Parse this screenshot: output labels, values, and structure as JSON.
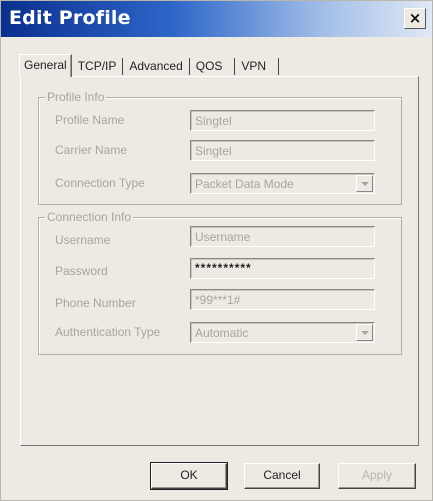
{
  "dialog": {
    "title": "Edit Profile",
    "close_label": "×"
  },
  "tabs": [
    {
      "label": "General",
      "active": true
    },
    {
      "label": "TCP/IP"
    },
    {
      "label": "Advanced"
    },
    {
      "label": "QOS"
    },
    {
      "label": "VPN"
    }
  ],
  "profile_info": {
    "legend": "Profile Info",
    "profile_name_label": "Profile Name",
    "profile_name_value": "Singtel",
    "carrier_name_label": "Carrier Name",
    "carrier_name_value": "Singtel",
    "connection_type_label": "Connection Type",
    "connection_type_value": "Packet Data Mode"
  },
  "connection_info": {
    "legend": "Connection Info",
    "username_label": "Username",
    "username_value": "Username",
    "password_label": "Password",
    "password_value": "**********",
    "phone_label": "Phone Number",
    "phone_value": "*99***1#",
    "auth_label": "Authentication Type",
    "auth_value": "Automatic"
  },
  "buttons": {
    "ok": "OK",
    "cancel": "Cancel",
    "apply": "Apply"
  }
}
